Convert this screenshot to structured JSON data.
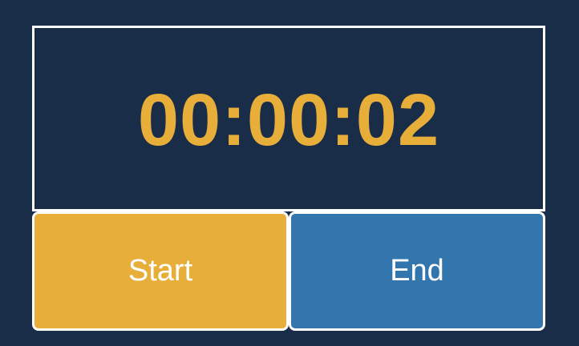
{
  "timer": {
    "display": "00:00:02"
  },
  "controls": {
    "start_label": "Start",
    "end_label": "End"
  },
  "colors": {
    "background": "#192d49",
    "digits": "#e7ae3a",
    "start_button": "#e7ae3a",
    "end_button": "#3375ad",
    "border": "#ffffff"
  }
}
